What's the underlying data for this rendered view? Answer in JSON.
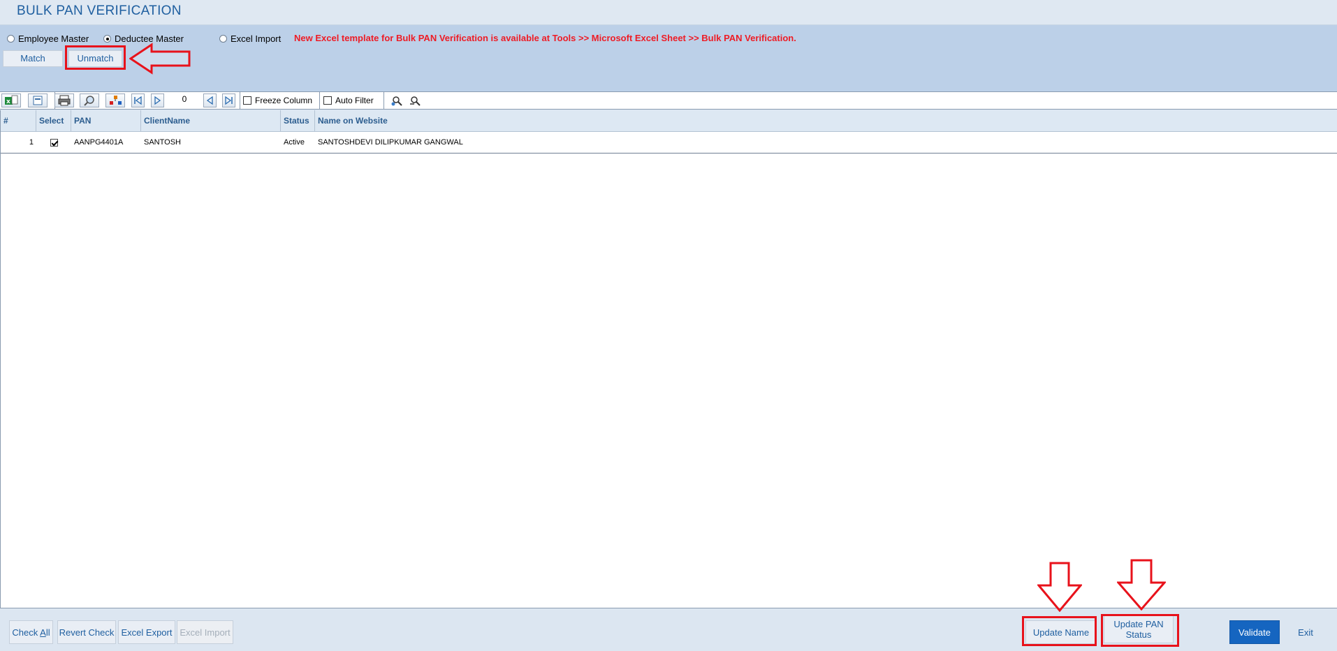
{
  "window": {
    "title": "BULK PAN VERIFICATION"
  },
  "options": {
    "radios": [
      {
        "label": "Employee Master",
        "selected": false
      },
      {
        "label": "Deductee Master",
        "selected": true
      },
      {
        "label": "Excel Import",
        "selected": false
      }
    ],
    "notice": "New Excel template for Bulk PAN Verification is available at Tools >> Microsoft Excel Sheet >> Bulk PAN Verification.",
    "tabs": [
      {
        "label": "Match",
        "active": false
      },
      {
        "label": "Unmatch",
        "active": true
      }
    ]
  },
  "toolbar": {
    "icons": [
      "excel-export-icon",
      "export-icon",
      "print-icon",
      "find-icon",
      "group-icon",
      "first-page-icon",
      "next-page-icon",
      "prev-page-icon",
      "last-page-icon",
      "filter-icon",
      "clear-filter-icon"
    ],
    "page_number": "0",
    "freeze_column_label": "Freeze Column",
    "auto_filter_label": "Auto Filter"
  },
  "grid": {
    "columns": [
      "#",
      "Select",
      "PAN",
      "ClientName",
      "Status",
      "Name on Website"
    ],
    "rows": [
      {
        "index": "1",
        "selected": true,
        "pan": "AANPG4401A",
        "client_name": "SANTOSH",
        "status": "Active",
        "name_on_website": "SANTOSHDEVI DILIPKUMAR GANGWAL"
      }
    ]
  },
  "footer": {
    "check_all": "Check All",
    "revert_check": "Revert Check",
    "excel_export": "Excel Export",
    "excel_import": "Excel Import",
    "update_name": "Update Name",
    "update_pan_status": "Update PAN Status",
    "validate": "Validate",
    "exit": "Exit"
  },
  "colors": {
    "accent": "#1f5fa0",
    "highlight": "#e8121b",
    "notice": "#ee1c25",
    "primary_button": "#1565c0"
  }
}
